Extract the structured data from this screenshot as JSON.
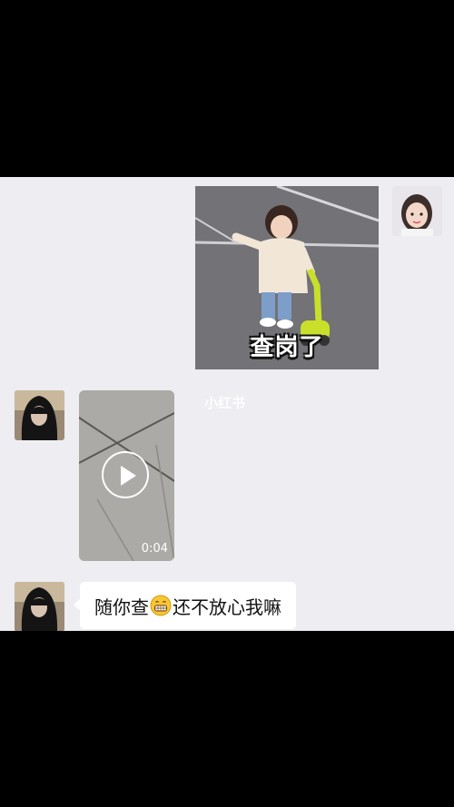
{
  "messages": [
    {
      "sender": "self",
      "type": "sticker",
      "caption": "查岗了"
    },
    {
      "sender": "other",
      "type": "video",
      "duration": "0:04"
    },
    {
      "sender": "other",
      "type": "text",
      "text_before": "随你查",
      "emoji": "grinning-face-emoji",
      "text_after": "还不放心我嘛"
    }
  ],
  "watermark": "小红书"
}
